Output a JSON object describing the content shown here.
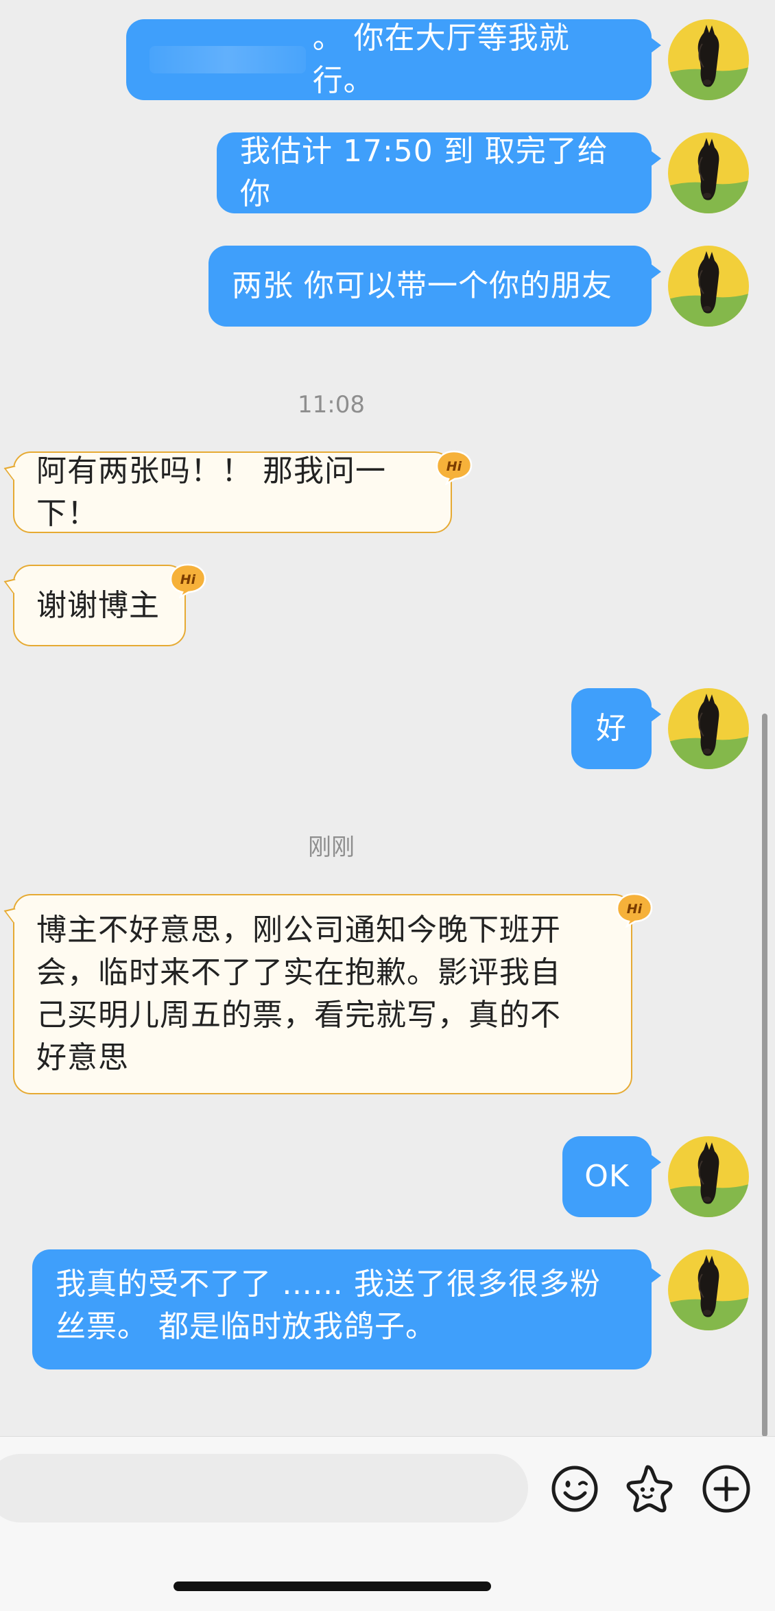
{
  "conversation": {
    "messages": [
      {
        "sender": "me",
        "text_visible": "。 你在大厅等我就行。",
        "partially_obscured": true
      },
      {
        "sender": "me",
        "text": "我估计 17:50 到 取完了给你"
      },
      {
        "sender": "me",
        "text": "两张 你可以带一个你的朋友"
      },
      {
        "type": "timestamp",
        "text": "11:08"
      },
      {
        "sender": "other",
        "text": "阿有两张吗！！ 那我问一下！",
        "badge": "Hi"
      },
      {
        "sender": "other",
        "text": "谢谢博主",
        "badge": "Hi"
      },
      {
        "sender": "me",
        "text": "好"
      },
      {
        "type": "timestamp",
        "text": "刚刚"
      },
      {
        "sender": "other",
        "lines": [
          "博主不好意思，刚公司通知今晚下班开",
          "会，临时来不了了实在抱歉。影评我自",
          "己买明儿周五的票，看完就写，真的不",
          "好意思"
        ],
        "badge": "Hi"
      },
      {
        "sender": "me",
        "text": "OK"
      },
      {
        "sender": "me",
        "lines": [
          "我真的受不了了 …… 我送了很多很多粉",
          "丝票。 都是临时放我鸽子。"
        ]
      }
    ]
  },
  "input_bar": {
    "placeholder": "",
    "buttons": [
      {
        "icon": "emoji-smiley-icon"
      },
      {
        "icon": "star-face-sticker-icon"
      },
      {
        "icon": "plus-circle-icon"
      }
    ]
  },
  "colors": {
    "outgoing_bubble": "#3f9ffb",
    "incoming_bubble": "#fffbf1",
    "incoming_border": "#e6aa33",
    "hi_badge": "#f6b13a",
    "background": "#ededed",
    "avatar_background": "#f2cf3a",
    "avatar_grass": "#84b84b"
  }
}
